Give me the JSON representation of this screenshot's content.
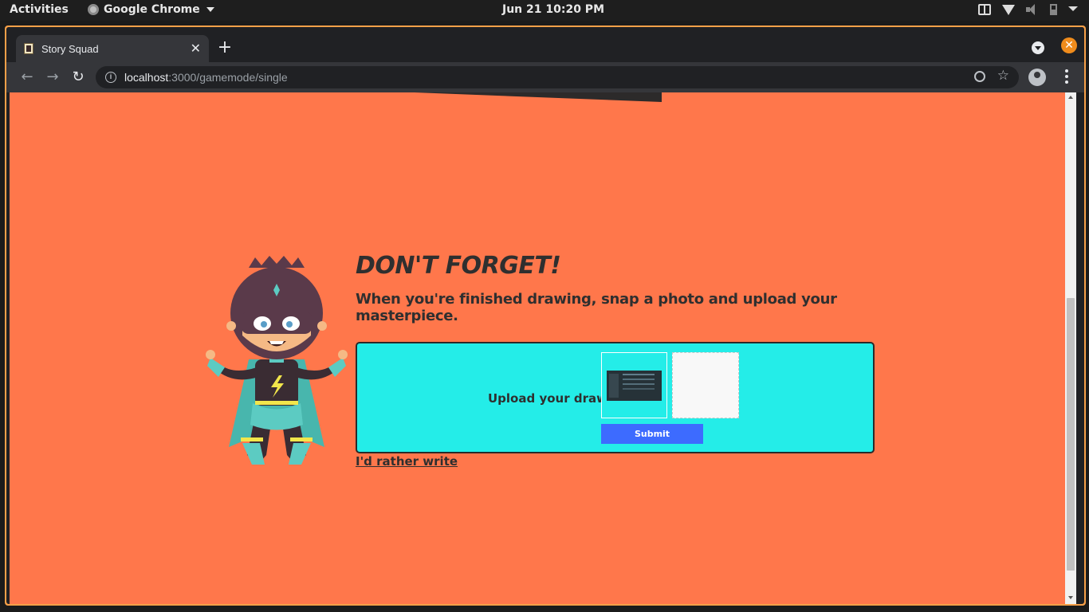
{
  "os_bar": {
    "activities": "Activities",
    "app_name": "Google Chrome",
    "clock": "Jun 21  10:20 PM"
  },
  "browser": {
    "tab_title": "Story Squad",
    "url_host": "localhost",
    "url_path": ":3000/gamemode/single",
    "window_accent": "#f08c1c"
  },
  "page": {
    "background": "#ff774b",
    "headline": "DON'T FORGET!",
    "subline": "When you're finished drawing, snap a photo and upload your masterpiece.",
    "upload_label": "Upload your drawing",
    "submit_label": "Submit",
    "alternate_link": "I'd rather write",
    "card_color": "#24ede8",
    "button_color": "#3d6bff"
  }
}
